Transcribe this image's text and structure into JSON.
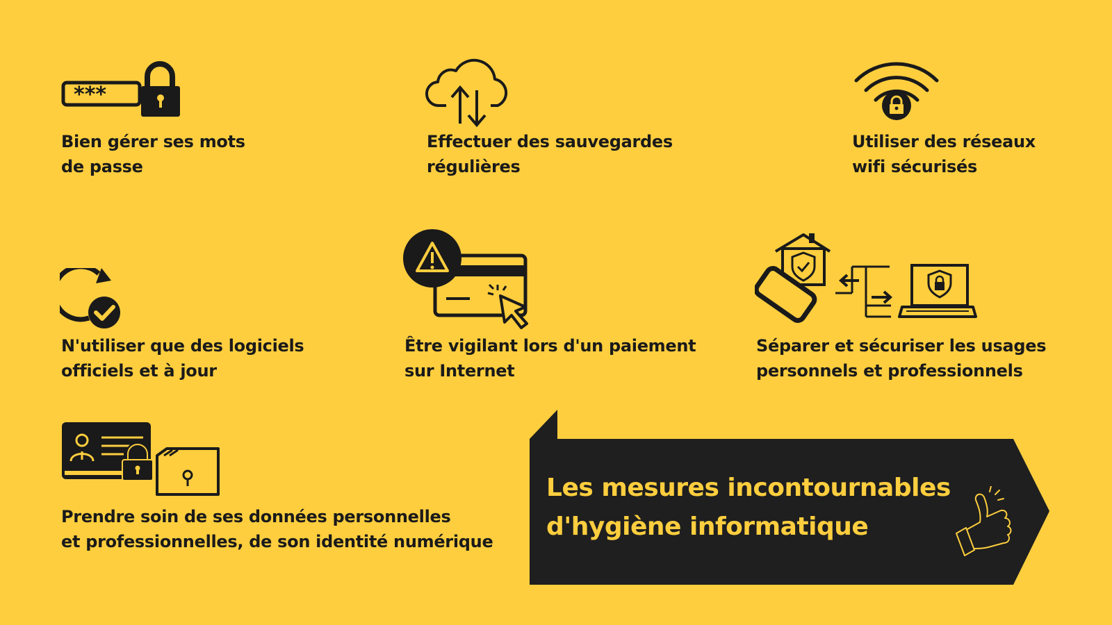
{
  "colors": {
    "background": "#FECE3E",
    "ink": "#1a1a1a",
    "banner": "#1f1f1f",
    "accent": "#FECE3E"
  },
  "items": [
    {
      "icon": "password-lock-icon",
      "lines": [
        "Bien gérer ses mots",
        "de passe"
      ]
    },
    {
      "icon": "cloud-sync-icon",
      "lines": [
        "Effectuer des sauvegardes",
        "régulières"
      ]
    },
    {
      "icon": "secure-wifi-icon",
      "lines": [
        "Utiliser des réseaux",
        "wifi sécurisés"
      ]
    },
    {
      "icon": "update-check-icon",
      "lines": [
        "N'utiliser que des logiciels",
        "officiels et à jour"
      ]
    },
    {
      "icon": "card-payment-warning-icon",
      "lines": [
        "Être vigilant lors d'un paiement",
        "sur Internet"
      ]
    },
    {
      "icon": "personal-professional-separation-icon",
      "lines": [
        "Séparer et sécuriser les usages",
        "personnels et professionnels"
      ]
    },
    {
      "icon": "identity-card-folder-lock-icon",
      "lines": [
        "Prendre soin de ses données personnelles",
        "et professionnelles, de son identité numérique"
      ]
    }
  ],
  "banner": {
    "lines": [
      "Les mesures incontournables",
      "d'hygiène informatique"
    ],
    "icon": "thumbs-up-icon"
  }
}
